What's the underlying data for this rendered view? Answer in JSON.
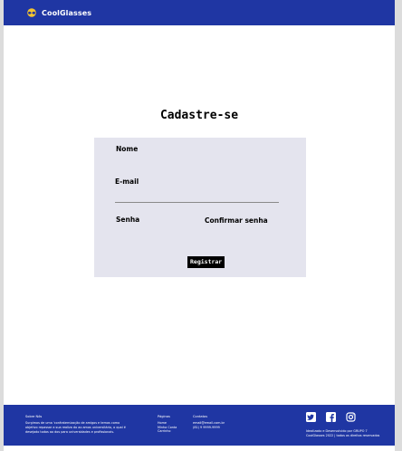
{
  "header": {
    "brand_name": "CoolGlasses"
  },
  "main": {
    "title": "Cadastre-se"
  },
  "form": {
    "name_label": "Nome",
    "email_label": "E-mail",
    "password_label": "Senha",
    "confirm_password_label": "Confirmar senha",
    "register_button_label": "Registrar",
    "name_value": "",
    "email_value": "",
    "password_value": "",
    "confirm_password_value": ""
  },
  "footer": {
    "about_heading": "Sobre Nós",
    "about_text": "Surgimos de uma 'confraternização de amigos e temos como objetivo repassar a sua realiza do ao amos universitário, o qual é desejado todos ao dos para universidades e profissionais.",
    "pages_heading": "Páginas",
    "pages_links": [
      "Home",
      "Minha Conta",
      "Carrinho"
    ],
    "contact_heading": "Contatos",
    "contact_email": "email@email.com.br",
    "contact_phone": "(81) 9 9999-9999",
    "credits_line1": "Idealizado e Desenvolvido por GRUPO 7",
    "credits_line2": "CoolGlasses 2022 | todos os direitos reservados"
  },
  "icons": {
    "twitter": "twitter-icon",
    "facebook": "facebook-icon",
    "instagram": "instagram-icon"
  },
  "colors": {
    "brand_blue": "#1f36a3",
    "form_background": "#e4e4ee",
    "button_background": "#000000",
    "logo_yellow": "#f4c430"
  }
}
